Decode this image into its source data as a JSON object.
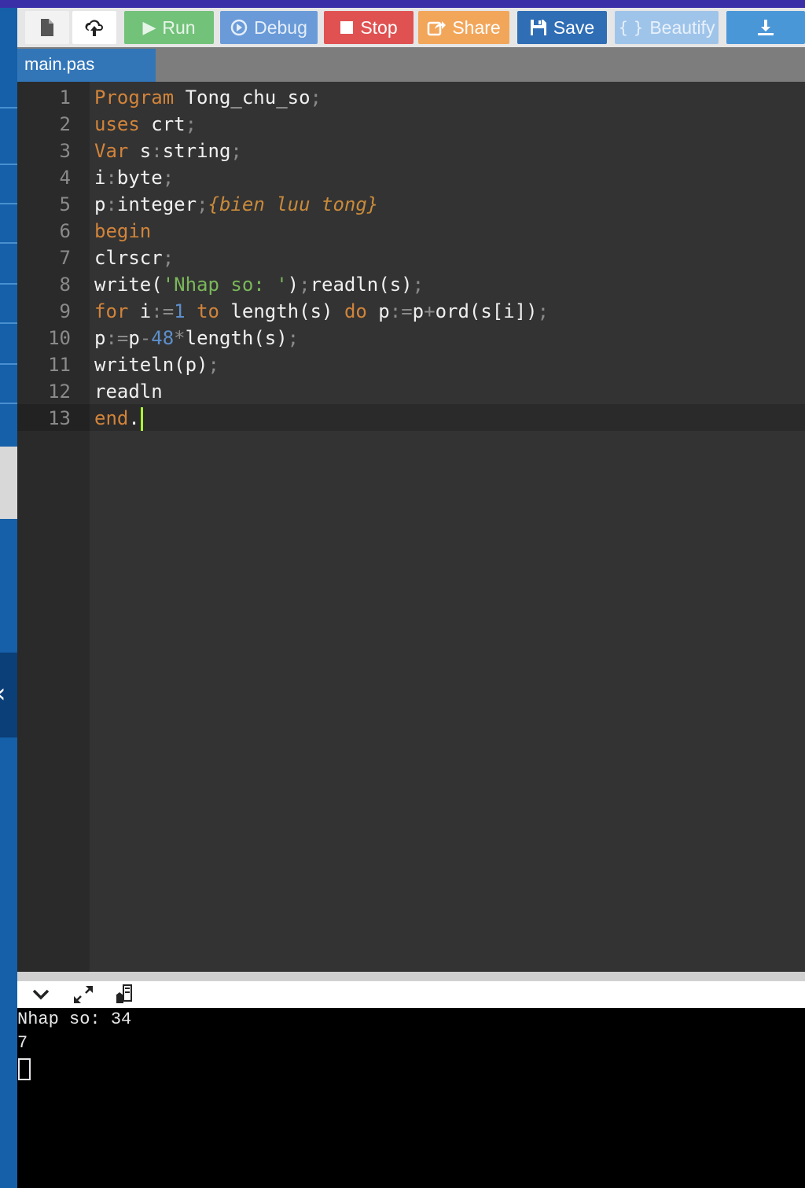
{
  "toolbar": {
    "buttons": [
      {
        "id": "new",
        "label": "",
        "icon": "file-icon"
      },
      {
        "id": "upload",
        "label": "",
        "icon": "upload-icon"
      },
      {
        "id": "run",
        "label": "Run",
        "icon": "play-icon"
      },
      {
        "id": "debug",
        "label": "Debug",
        "icon": "debug-icon"
      },
      {
        "id": "stop",
        "label": "Stop",
        "icon": "stop-icon"
      },
      {
        "id": "share",
        "label": "Share",
        "icon": "share-icon"
      },
      {
        "id": "save",
        "label": "Save",
        "icon": "floppy-icon"
      },
      {
        "id": "beautify",
        "label": "Beautify",
        "icon": "braces-icon"
      },
      {
        "id": "download",
        "label": "",
        "icon": "download-icon"
      }
    ]
  },
  "tabs": [
    {
      "label": "main.pas",
      "active": true
    }
  ],
  "editor": {
    "language": "pascal",
    "active_line": 13,
    "lines": [
      {
        "n": "1",
        "tokens": [
          {
            "t": "Program",
            "c": "k"
          },
          {
            "t": " Tong_chu_so",
            "c": ""
          },
          {
            "t": ";",
            "c": "p"
          }
        ]
      },
      {
        "n": "2",
        "tokens": [
          {
            "t": "uses",
            "c": "k"
          },
          {
            "t": " crt",
            "c": ""
          },
          {
            "t": ";",
            "c": "p"
          }
        ]
      },
      {
        "n": "3",
        "tokens": [
          {
            "t": "Var",
            "c": "k"
          },
          {
            "t": " s",
            "c": ""
          },
          {
            "t": ":",
            "c": "p"
          },
          {
            "t": "string",
            "c": ""
          },
          {
            "t": ";",
            "c": "p"
          }
        ]
      },
      {
        "n": "4",
        "tokens": [
          {
            "t": "i",
            "c": ""
          },
          {
            "t": ":",
            "c": "p"
          },
          {
            "t": "byte",
            "c": ""
          },
          {
            "t": ";",
            "c": "p"
          }
        ]
      },
      {
        "n": "5",
        "tokens": [
          {
            "t": "p",
            "c": ""
          },
          {
            "t": ":",
            "c": "p"
          },
          {
            "t": "integer",
            "c": ""
          },
          {
            "t": ";",
            "c": "p"
          },
          {
            "t": "{bien luu tong}",
            "c": "cm"
          }
        ]
      },
      {
        "n": "6",
        "tokens": [
          {
            "t": "begin",
            "c": "k"
          }
        ]
      },
      {
        "n": "7",
        "tokens": [
          {
            "t": "clrscr",
            "c": ""
          },
          {
            "t": ";",
            "c": "p"
          }
        ]
      },
      {
        "n": "8",
        "tokens": [
          {
            "t": "write(",
            "c": ""
          },
          {
            "t": "'Nhap so: '",
            "c": "st"
          },
          {
            "t": ")",
            "c": ""
          },
          {
            "t": ";",
            "c": "p"
          },
          {
            "t": "readln(s)",
            "c": ""
          },
          {
            "t": ";",
            "c": "p"
          }
        ]
      },
      {
        "n": "9",
        "tokens": [
          {
            "t": "for",
            "c": "k"
          },
          {
            "t": " i",
            "c": ""
          },
          {
            "t": ":=",
            "c": "p"
          },
          {
            "t": "1",
            "c": "nu"
          },
          {
            "t": " ",
            "c": ""
          },
          {
            "t": "to",
            "c": "k"
          },
          {
            "t": " length(s) ",
            "c": ""
          },
          {
            "t": "do",
            "c": "k"
          },
          {
            "t": " p",
            "c": ""
          },
          {
            "t": ":=",
            "c": "p"
          },
          {
            "t": "p",
            "c": ""
          },
          {
            "t": "+",
            "c": "p"
          },
          {
            "t": "ord(s[i])",
            "c": ""
          },
          {
            "t": ";",
            "c": "p"
          }
        ]
      },
      {
        "n": "10",
        "tokens": [
          {
            "t": "p",
            "c": ""
          },
          {
            "t": ":=",
            "c": "p"
          },
          {
            "t": "p",
            "c": ""
          },
          {
            "t": "-",
            "c": "p"
          },
          {
            "t": "48",
            "c": "nu"
          },
          {
            "t": "*",
            "c": "p"
          },
          {
            "t": "length(s)",
            "c": ""
          },
          {
            "t": ";",
            "c": "p"
          }
        ]
      },
      {
        "n": "11",
        "tokens": [
          {
            "t": "writeln(p)",
            "c": ""
          },
          {
            "t": ";",
            "c": "p"
          }
        ]
      },
      {
        "n": "12",
        "tokens": [
          {
            "t": "readln",
            "c": ""
          }
        ]
      },
      {
        "n": "13",
        "tokens": [
          {
            "t": "end",
            "c": "k"
          },
          {
            "t": ".",
            "c": ""
          }
        ]
      }
    ]
  },
  "console": {
    "toolbar_icons": [
      "chevron-down-icon",
      "expand-icon",
      "clear-console-icon"
    ],
    "output": [
      "Nhap so: 34",
      "7"
    ]
  },
  "colors": {
    "editor_bg": "#333333",
    "keyword": "#d2843a",
    "string": "#7ab85a",
    "number": "#5d8fcc",
    "console_bg": "#000000"
  }
}
